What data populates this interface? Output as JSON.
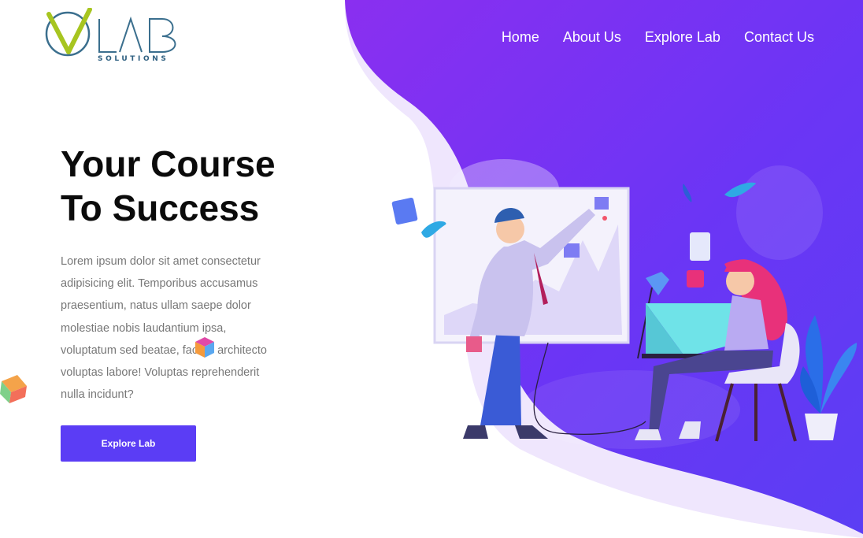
{
  "brand": {
    "logo_letters": "VLAB",
    "logo_subtitle": "SOLUTIONS",
    "colors": {
      "logo_v": "#a7c520",
      "logo_ring": "#3b6f8e",
      "logo_text": "#2e5f80"
    }
  },
  "nav": {
    "items": [
      {
        "label": "Home"
      },
      {
        "label": "About Us"
      },
      {
        "label": "Explore Lab"
      },
      {
        "label": "Contact Us"
      }
    ]
  },
  "hero": {
    "title_line1": "Your Course",
    "title_line2": "To Success",
    "description": "Lorem ipsum dolor sit amet consectetur adipisicing elit. Temporibus accusamus praesentium, natus ullam saepe dolor molestiae nobis laudantium ipsa, voluptatum sed beatae, facere architecto voluptas labore! Voluptas reprehenderit nulla incidunt?",
    "cta_label": "Explore Lab"
  },
  "theme": {
    "accent": "#5b3df5",
    "gradient_start": "#7b2ff7",
    "gradient_end": "#5a3cf4",
    "hero_title_color": "#0b0b0b",
    "text_color": "#777777"
  },
  "decorations": {
    "cube_icon": "gradient-cube-icon",
    "illustration": "team-at-whiteboard-illustration"
  }
}
